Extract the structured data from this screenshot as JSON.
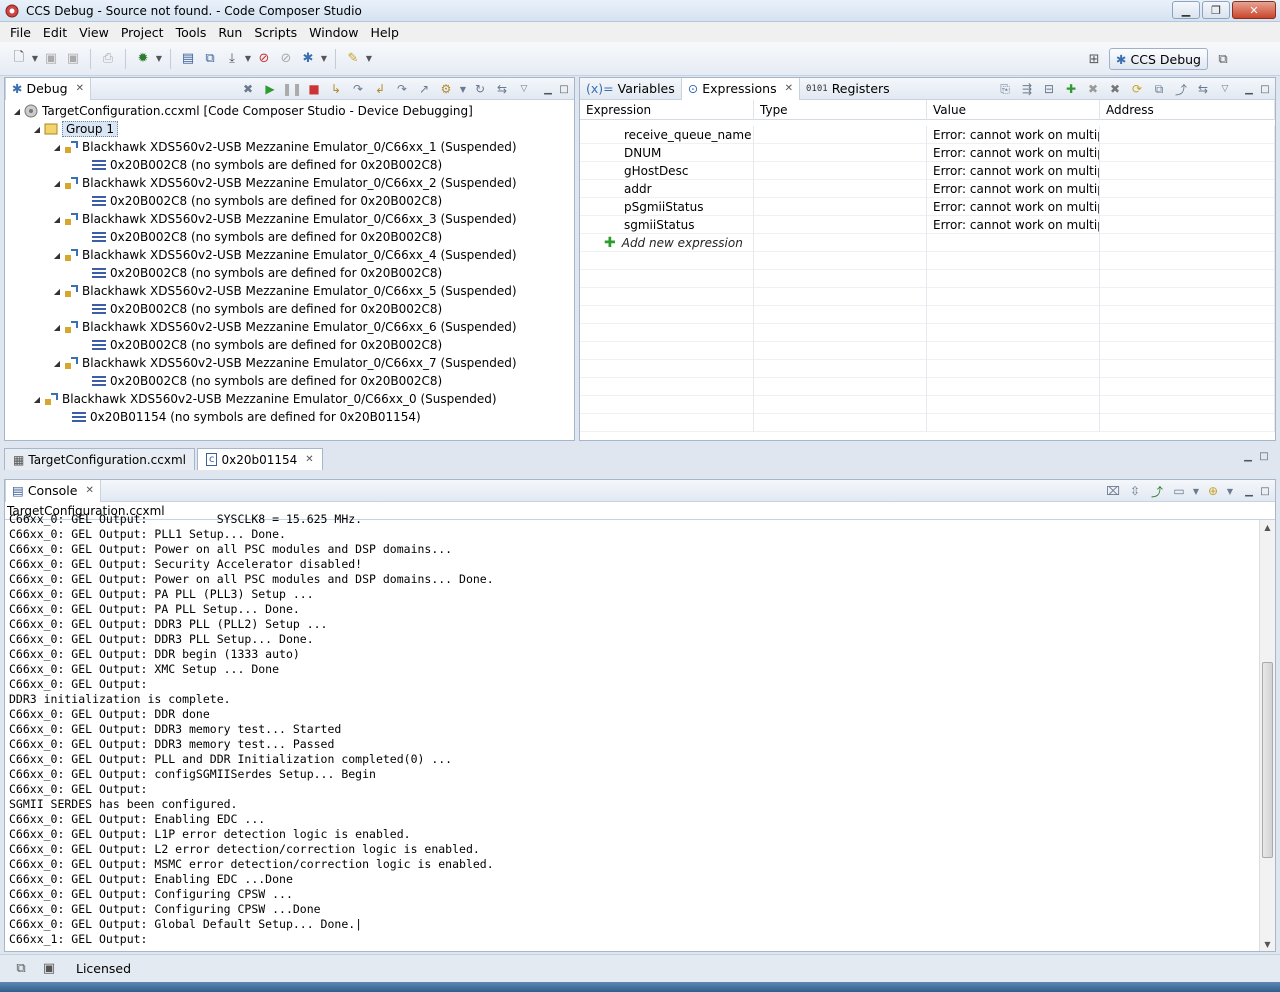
{
  "window": {
    "title": "CCS Debug - Source not found. - Code Composer Studio"
  },
  "menu": [
    "File",
    "Edit",
    "View",
    "Project",
    "Tools",
    "Run",
    "Scripts",
    "Window",
    "Help"
  ],
  "perspective": {
    "label": "CCS Debug"
  },
  "debug_view": {
    "tab_label": "Debug",
    "root": "TargetConfiguration.ccxml [Code Composer Studio - Device Debugging]",
    "group": "Group 1",
    "cores": [
      {
        "name": "Blackhawk XDS560v2-USB Mezzanine Emulator_0/C66xx_1 (Suspended)",
        "frame": "0x20B002C8  (no symbols are defined for 0x20B002C8)"
      },
      {
        "name": "Blackhawk XDS560v2-USB Mezzanine Emulator_0/C66xx_2 (Suspended)",
        "frame": "0x20B002C8  (no symbols are defined for 0x20B002C8)"
      },
      {
        "name": "Blackhawk XDS560v2-USB Mezzanine Emulator_0/C66xx_3 (Suspended)",
        "frame": "0x20B002C8  (no symbols are defined for 0x20B002C8)"
      },
      {
        "name": "Blackhawk XDS560v2-USB Mezzanine Emulator_0/C66xx_4 (Suspended)",
        "frame": "0x20B002C8  (no symbols are defined for 0x20B002C8)"
      },
      {
        "name": "Blackhawk XDS560v2-USB Mezzanine Emulator_0/C66xx_5 (Suspended)",
        "frame": "0x20B002C8  (no symbols are defined for 0x20B002C8)"
      },
      {
        "name": "Blackhawk XDS560v2-USB Mezzanine Emulator_0/C66xx_6 (Suspended)",
        "frame": "0x20B002C8  (no symbols are defined for 0x20B002C8)"
      },
      {
        "name": "Blackhawk XDS560v2-USB Mezzanine Emulator_0/C66xx_7 (Suspended)",
        "frame": "0x20B002C8  (no symbols are defined for 0x20B002C8)"
      }
    ],
    "core0": {
      "name": "Blackhawk XDS560v2-USB Mezzanine Emulator_0/C66xx_0 (Suspended)",
      "frame": "0x20B01154  (no symbols are defined for 0x20B01154)"
    }
  },
  "expressions_view": {
    "tabs": [
      "Variables",
      "Expressions",
      "Registers"
    ],
    "columns": [
      "Expression",
      "Type",
      "Value",
      "Address"
    ],
    "rows": [
      {
        "name": "receive_queue_name",
        "type": "",
        "value": "Error: cannot work on multipl...",
        "address": ""
      },
      {
        "name": "DNUM",
        "type": "",
        "value": "Error: cannot work on multipl...",
        "address": ""
      },
      {
        "name": "gHostDesc",
        "type": "",
        "value": "Error: cannot work on multipl...",
        "address": ""
      },
      {
        "name": "addr",
        "type": "",
        "value": "Error: cannot work on multipl...",
        "address": ""
      },
      {
        "name": "pSgmiiStatus",
        "type": "",
        "value": "Error: cannot work on multipl...",
        "address": ""
      },
      {
        "name": "sgmiiStatus",
        "type": "",
        "value": "Error: cannot work on multipl...",
        "address": ""
      }
    ],
    "add_new": "Add new expression"
  },
  "editor_tabs": [
    "TargetConfiguration.ccxml",
    "0x20b01154"
  ],
  "console": {
    "tab_label": "Console",
    "subtitle": "TargetConfiguration.ccxml",
    "lines": [
      "C66xx_0: GEL Output:          SYSCLK8 = 15.625 MHz.",
      "C66xx_0: GEL Output: PLL1 Setup... Done.",
      "C66xx_0: GEL Output: Power on all PSC modules and DSP domains...",
      "C66xx_0: GEL Output: Security Accelerator disabled!",
      "C66xx_0: GEL Output: Power on all PSC modules and DSP domains... Done.",
      "C66xx_0: GEL Output: PA PLL (PLL3) Setup ...",
      "C66xx_0: GEL Output: PA PLL Setup... Done.",
      "C66xx_0: GEL Output: DDR3 PLL (PLL2) Setup ...",
      "C66xx_0: GEL Output: DDR3 PLL Setup... Done.",
      "C66xx_0: GEL Output: DDR begin (1333 auto)",
      "C66xx_0: GEL Output: XMC Setup ... Done",
      "C66xx_0: GEL Output: ",
      "DDR3 initialization is complete.",
      "C66xx_0: GEL Output: DDR done",
      "C66xx_0: GEL Output: DDR3 memory test... Started",
      "C66xx_0: GEL Output: DDR3 memory test... Passed",
      "C66xx_0: GEL Output: PLL and DDR Initialization completed(0) ...",
      "C66xx_0: GEL Output: configSGMIISerdes Setup... Begin",
      "C66xx_0: GEL Output: ",
      "SGMII SERDES has been configured.",
      "C66xx_0: GEL Output: Enabling EDC ...",
      "C66xx_0: GEL Output: L1P error detection logic is enabled.",
      "C66xx_0: GEL Output: L2 error detection/correction logic is enabled.",
      "C66xx_0: GEL Output: MSMC error detection/correction logic is enabled.",
      "C66xx_0: GEL Output: Enabling EDC ...Done",
      "C66xx_0: GEL Output: Configuring CPSW ...",
      "C66xx_0: GEL Output: Configuring CPSW ...Done",
      "C66xx_0: GEL Output: Global Default Setup... Done.|",
      "C66xx_1: GEL Output: "
    ]
  },
  "status": {
    "license": "Licensed"
  }
}
